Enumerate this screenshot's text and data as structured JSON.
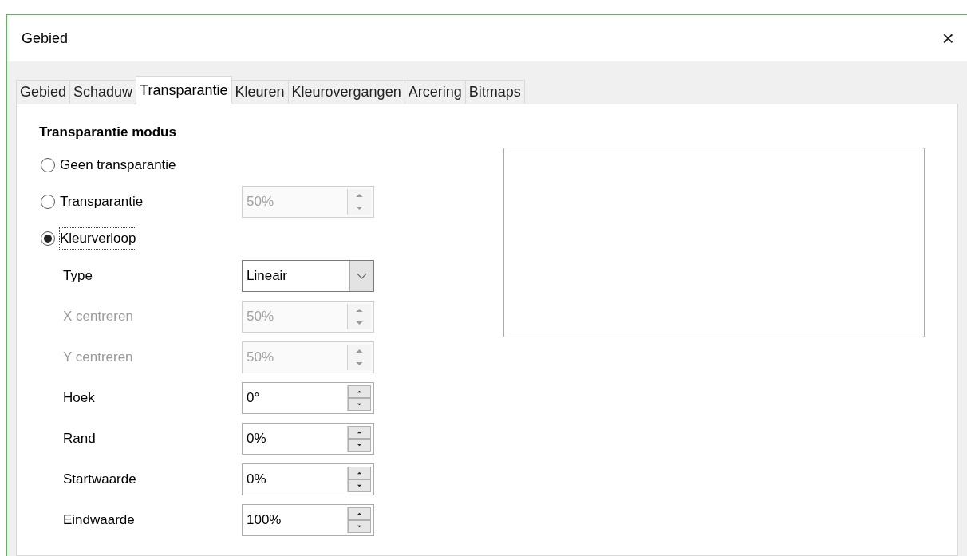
{
  "window": {
    "title": "Gebied",
    "close": "×"
  },
  "tabs": [
    {
      "label": "Gebied",
      "selected": false
    },
    {
      "label": "Schaduw",
      "selected": false
    },
    {
      "label": "Transparantie",
      "selected": true
    },
    {
      "label": "Kleuren",
      "selected": false
    },
    {
      "label": "Kleurovergangen",
      "selected": false
    },
    {
      "label": "Arcering",
      "selected": false
    },
    {
      "label": "Bitmaps",
      "selected": false
    }
  ],
  "section_title": "Transparantie modus",
  "modes": [
    {
      "label": "Geen transparantie",
      "selected": false,
      "focused": false
    },
    {
      "label": "Transparantie",
      "selected": false,
      "focused": false,
      "spin": {
        "value": "50%",
        "disabled": true
      }
    },
    {
      "label": "Kleurverloop",
      "selected": true,
      "focused": true
    }
  ],
  "gradient_fields": [
    {
      "kind": "dropdown",
      "label": "Type",
      "value": "Lineair",
      "disabled": false
    },
    {
      "kind": "spin",
      "label": "X centreren",
      "value": "50%",
      "disabled": true
    },
    {
      "kind": "spin",
      "label": "Y centreren",
      "value": "50%",
      "disabled": true
    },
    {
      "kind": "spin",
      "label": "Hoek",
      "value": "0°",
      "disabled": false
    },
    {
      "kind": "spin",
      "label": "Rand",
      "value": "0%",
      "disabled": false
    },
    {
      "kind": "spin",
      "label": "Startwaarde",
      "value": "0%",
      "disabled": false
    },
    {
      "kind": "spin",
      "label": "Eindwaarde",
      "value": "100%",
      "disabled": false
    }
  ]
}
